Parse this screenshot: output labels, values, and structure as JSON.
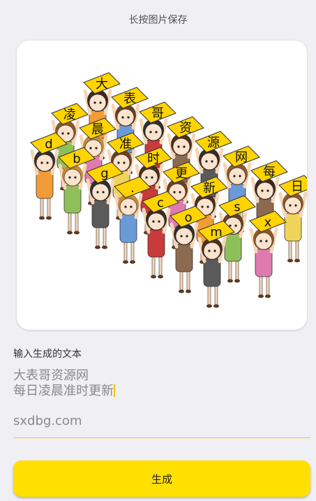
{
  "header": {
    "hint": "长按图片保存"
  },
  "poster": {
    "lines": [
      [
        "大",
        "表",
        "哥",
        "资",
        "源",
        "网",
        "每",
        "日"
      ],
      [
        "凌",
        "晨",
        "准",
        "时",
        "更",
        "新"
      ],
      [
        "d",
        "b",
        "g",
        ".",
        "c",
        "o",
        "m"
      ],
      [
        "s",
        "x"
      ]
    ],
    "hat_color": "#ffd400"
  },
  "form": {
    "label": "输入生成的文本",
    "textarea_value": "大表哥资源网\n每日凌晨准时更新",
    "input_value": "sxdbg.com"
  },
  "generate_button": {
    "label": "生成"
  },
  "colors": {
    "accent": "#ffe000",
    "background": "#efeff4"
  }
}
